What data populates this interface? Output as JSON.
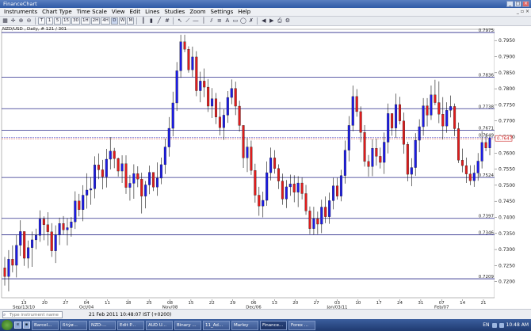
{
  "window": {
    "title": "FinanceChart"
  },
  "menu": [
    "Instruments",
    "Chart Type",
    "Time Scale",
    "View",
    "Edit",
    "Lines",
    "Studies",
    "Zoom",
    "Settings",
    "Help"
  ],
  "toolbar": {
    "buttons": [
      "T",
      "1",
      "5",
      "15",
      "30",
      "1H",
      "2H",
      "4H",
      "D",
      "W",
      "M"
    ],
    "active": "D"
  },
  "chart_info": "NZD/USD , Daily, # 121 / 301",
  "chart_data": {
    "type": "candlestick",
    "instrument": "NZD/USD",
    "timeframe": "Daily",
    "ylim": [
      0.715,
      0.7985
    ],
    "price_ticks": [
      "0.7950",
      "0.7900",
      "0.7850",
      "0.7800",
      "0.7750",
      "0.7700",
      "0.7650",
      "0.7600",
      "0.7550",
      "0.7500",
      "0.7450",
      "0.7400",
      "0.7350",
      "0.7300",
      "0.7250",
      "0.7200"
    ],
    "levels": [
      {
        "value": 0.7975,
        "label": "0.7975"
      },
      {
        "value": 0.7836,
        "label": "0.7836"
      },
      {
        "value": 0.7738,
        "label": "0.7738"
      },
      {
        "value": 0.7671,
        "label": "0.7671"
      },
      {
        "value": 0.7524,
        "label": "0.7524"
      },
      {
        "value": 0.7397,
        "label": "0.7397"
      },
      {
        "value": 0.7346,
        "label": "0.7346"
      },
      {
        "value": 0.7209,
        "label": "0.7209"
      }
    ],
    "bid": {
      "value": 0.7649,
      "label": "0.7649"
    },
    "ask": {
      "value": 0.7647,
      "label": "0.7647"
    },
    "date_ticks": [
      "13",
      "20",
      "27",
      "04",
      "11",
      "18",
      "25",
      "08",
      "15",
      "22",
      "29",
      "06",
      "13",
      "20",
      "27",
      "03",
      "10",
      "17",
      "24",
      "31",
      "07",
      "14",
      "21"
    ],
    "period_labels": [
      "Sep/13/10",
      "Oct/04",
      "Nov/08",
      "Dec/06",
      "Jan/03/11",
      "Feb/07"
    ],
    "candles": [
      [
        0.7243,
        0.7277,
        0.7188,
        0.7216
      ],
      [
        0.7216,
        0.7298,
        0.717,
        0.727
      ],
      [
        0.727,
        0.7313,
        0.7229,
        0.7251
      ],
      [
        0.7251,
        0.7345,
        0.7213,
        0.7313
      ],
      [
        0.7313,
        0.7391,
        0.728,
        0.7356
      ],
      [
        0.7356,
        0.7356,
        0.7249,
        0.7273
      ],
      [
        0.7273,
        0.7328,
        0.7242,
        0.7306
      ],
      [
        0.7306,
        0.7356,
        0.7246,
        0.733
      ],
      [
        0.733,
        0.7365,
        0.7301,
        0.7344
      ],
      [
        0.7344,
        0.7422,
        0.7324,
        0.7395
      ],
      [
        0.7395,
        0.7403,
        0.7329,
        0.7377
      ],
      [
        0.7377,
        0.7416,
        0.7312,
        0.7355
      ],
      [
        0.7355,
        0.7382,
        0.7277,
        0.7296
      ],
      [
        0.7296,
        0.7375,
        0.7258,
        0.7345
      ],
      [
        0.7345,
        0.7399,
        0.7314,
        0.7381
      ],
      [
        0.7381,
        0.7404,
        0.7347,
        0.7361
      ],
      [
        0.7361,
        0.7398,
        0.7313,
        0.7368
      ],
      [
        0.7368,
        0.7401,
        0.734,
        0.7386
      ],
      [
        0.7386,
        0.7481,
        0.7364,
        0.7451
      ],
      [
        0.7451,
        0.7473,
        0.7403,
        0.7424
      ],
      [
        0.7424,
        0.75,
        0.7388,
        0.7469
      ],
      [
        0.7469,
        0.7537,
        0.7427,
        0.7485
      ],
      [
        0.7485,
        0.7525,
        0.7439,
        0.7489
      ],
      [
        0.7489,
        0.759,
        0.7459,
        0.7563
      ],
      [
        0.7563,
        0.7599,
        0.7519,
        0.7548
      ],
      [
        0.7548,
        0.7579,
        0.7487,
        0.7526
      ],
      [
        0.7526,
        0.7613,
        0.7493,
        0.7581
      ],
      [
        0.7581,
        0.765,
        0.7549,
        0.7606
      ],
      [
        0.7606,
        0.7616,
        0.7553,
        0.7583
      ],
      [
        0.7583,
        0.7586,
        0.7527,
        0.7544
      ],
      [
        0.7544,
        0.7593,
        0.7507,
        0.7567
      ],
      [
        0.7567,
        0.7593,
        0.7473,
        0.7493
      ],
      [
        0.7493,
        0.7532,
        0.7452,
        0.7506
      ],
      [
        0.7506,
        0.7565,
        0.7458,
        0.7536
      ],
      [
        0.7536,
        0.7559,
        0.7494,
        0.7519
      ],
      [
        0.7519,
        0.7539,
        0.7412,
        0.7466
      ],
      [
        0.7466,
        0.7513,
        0.7428,
        0.7501
      ],
      [
        0.7501,
        0.7561,
        0.7472,
        0.754
      ],
      [
        0.754,
        0.754,
        0.7482,
        0.7494
      ],
      [
        0.7494,
        0.7571,
        0.7467,
        0.7522
      ],
      [
        0.7522,
        0.7586,
        0.7503,
        0.7564
      ],
      [
        0.7564,
        0.7645,
        0.7535,
        0.7619
      ],
      [
        0.7619,
        0.7712,
        0.7589,
        0.7677
      ],
      [
        0.7677,
        0.7791,
        0.7652,
        0.7756
      ],
      [
        0.7756,
        0.7883,
        0.7731,
        0.7856
      ],
      [
        0.7856,
        0.7968,
        0.7834,
        0.7946
      ],
      [
        0.7946,
        0.7968,
        0.7914,
        0.7923
      ],
      [
        0.7923,
        0.7932,
        0.785,
        0.7859
      ],
      [
        0.7859,
        0.7931,
        0.7837,
        0.7899
      ],
      [
        0.7899,
        0.7917,
        0.7777,
        0.7794
      ],
      [
        0.7794,
        0.7853,
        0.7758,
        0.7824
      ],
      [
        0.7824,
        0.7863,
        0.7774,
        0.7805
      ],
      [
        0.7805,
        0.783,
        0.7728,
        0.7746
      ],
      [
        0.7746,
        0.7802,
        0.7709,
        0.7769
      ],
      [
        0.7769,
        0.7787,
        0.769,
        0.7712
      ],
      [
        0.7712,
        0.7759,
        0.7655,
        0.7679
      ],
      [
        0.7679,
        0.7736,
        0.7641,
        0.7718
      ],
      [
        0.7718,
        0.7793,
        0.7694,
        0.7773
      ],
      [
        0.7773,
        0.7829,
        0.7752,
        0.7801
      ],
      [
        0.7801,
        0.7822,
        0.7718,
        0.7746
      ],
      [
        0.7746,
        0.7763,
        0.7667,
        0.7686
      ],
      [
        0.7686,
        0.7686,
        0.7554,
        0.7585
      ],
      [
        0.7585,
        0.7647,
        0.7541,
        0.7619
      ],
      [
        0.7619,
        0.7639,
        0.7532,
        0.7546
      ],
      [
        0.7546,
        0.7567,
        0.7446,
        0.7469
      ],
      [
        0.7469,
        0.7495,
        0.7405,
        0.7435
      ],
      [
        0.7435,
        0.748,
        0.74,
        0.7453
      ],
      [
        0.7453,
        0.7574,
        0.7436,
        0.7539
      ],
      [
        0.7539,
        0.7617,
        0.7515,
        0.7585
      ],
      [
        0.7585,
        0.7609,
        0.7536,
        0.7552
      ],
      [
        0.7552,
        0.7565,
        0.7488,
        0.7513
      ],
      [
        0.7513,
        0.7536,
        0.7439,
        0.7457
      ],
      [
        0.7457,
        0.7516,
        0.7429,
        0.7495
      ],
      [
        0.7495,
        0.7533,
        0.7467,
        0.7504
      ],
      [
        0.7504,
        0.7531,
        0.7447,
        0.7478
      ],
      [
        0.7478,
        0.7528,
        0.7432,
        0.7507
      ],
      [
        0.7507,
        0.7524,
        0.7456,
        0.7474
      ],
      [
        0.7474,
        0.7501,
        0.7408,
        0.742
      ],
      [
        0.742,
        0.7434,
        0.7348,
        0.7365
      ],
      [
        0.7365,
        0.7433,
        0.7346,
        0.7396
      ],
      [
        0.7396,
        0.7418,
        0.7348,
        0.7379
      ],
      [
        0.7379,
        0.7455,
        0.7351,
        0.7432
      ],
      [
        0.7432,
        0.7465,
        0.7382,
        0.7402
      ],
      [
        0.7402,
        0.7477,
        0.738,
        0.7452
      ],
      [
        0.7452,
        0.7523,
        0.7425,
        0.7498
      ],
      [
        0.7498,
        0.7523,
        0.7455,
        0.7466
      ],
      [
        0.7466,
        0.7548,
        0.745,
        0.753
      ],
      [
        0.753,
        0.7639,
        0.7505,
        0.7609
      ],
      [
        0.7609,
        0.7715,
        0.7574,
        0.7686
      ],
      [
        0.7686,
        0.781,
        0.7668,
        0.7776
      ],
      [
        0.7776,
        0.7799,
        0.7713,
        0.7729
      ],
      [
        0.7729,
        0.7745,
        0.7634,
        0.7664
      ],
      [
        0.7664,
        0.7687,
        0.7558,
        0.7574
      ],
      [
        0.7574,
        0.7594,
        0.7527,
        0.7558
      ],
      [
        0.7558,
        0.7643,
        0.7528,
        0.7615
      ],
      [
        0.7615,
        0.7645,
        0.7561,
        0.759
      ],
      [
        0.759,
        0.7617,
        0.7552,
        0.7571
      ],
      [
        0.7571,
        0.7664,
        0.7535,
        0.7634
      ],
      [
        0.7634,
        0.7754,
        0.7599,
        0.7723
      ],
      [
        0.7723,
        0.7723,
        0.7654,
        0.7678
      ],
      [
        0.7678,
        0.7785,
        0.7648,
        0.7751
      ],
      [
        0.7751,
        0.7775,
        0.7689,
        0.77
      ],
      [
        0.77,
        0.7726,
        0.7598,
        0.7627
      ],
      [
        0.7627,
        0.7635,
        0.7512,
        0.7534
      ],
      [
        0.7534,
        0.7584,
        0.7497,
        0.7555
      ],
      [
        0.7555,
        0.7662,
        0.7529,
        0.764
      ],
      [
        0.764,
        0.7705,
        0.7603,
        0.7682
      ],
      [
        0.7682,
        0.7771,
        0.7654,
        0.7747
      ],
      [
        0.7747,
        0.7771,
        0.7683,
        0.7718
      ],
      [
        0.7718,
        0.781,
        0.7703,
        0.7781
      ],
      [
        0.7781,
        0.7828,
        0.7749,
        0.7757
      ],
      [
        0.7757,
        0.7823,
        0.7693,
        0.7721
      ],
      [
        0.7721,
        0.7774,
        0.7642,
        0.7684
      ],
      [
        0.7684,
        0.7758,
        0.7663,
        0.7733
      ],
      [
        0.7733,
        0.7779,
        0.7711,
        0.7745
      ],
      [
        0.7745,
        0.7754,
        0.7653,
        0.7676
      ],
      [
        0.7676,
        0.7695,
        0.7569,
        0.7578
      ],
      [
        0.7578,
        0.7614,
        0.754,
        0.7561
      ],
      [
        0.7561,
        0.7586,
        0.7507,
        0.7535
      ],
      [
        0.7535,
        0.7562,
        0.75,
        0.7514
      ],
      [
        0.7514,
        0.7563,
        0.7495,
        0.7538
      ],
      [
        0.7538,
        0.76,
        0.7514,
        0.7575
      ],
      [
        0.7575,
        0.7668,
        0.7552,
        0.7633
      ],
      [
        0.7633,
        0.766,
        0.7606,
        0.7616
      ],
      [
        0.7616,
        0.7653,
        0.7593,
        0.7647
      ]
    ]
  },
  "status": {
    "instrument_placeholder": "Type instrument name",
    "datetime": "21 Feb 2011 10:48:07  IST (+0200)"
  },
  "taskbar": {
    "items": [
      "Barcel...",
      "ßñýø...",
      "NZD-...",
      "Edit P...",
      "AUD U...",
      "Binary ...",
      "11_Ad...",
      "Marley",
      "Finance...",
      "Forex ..."
    ],
    "active": "Finance...",
    "language": "EN",
    "clock": "10:48 AM"
  }
}
